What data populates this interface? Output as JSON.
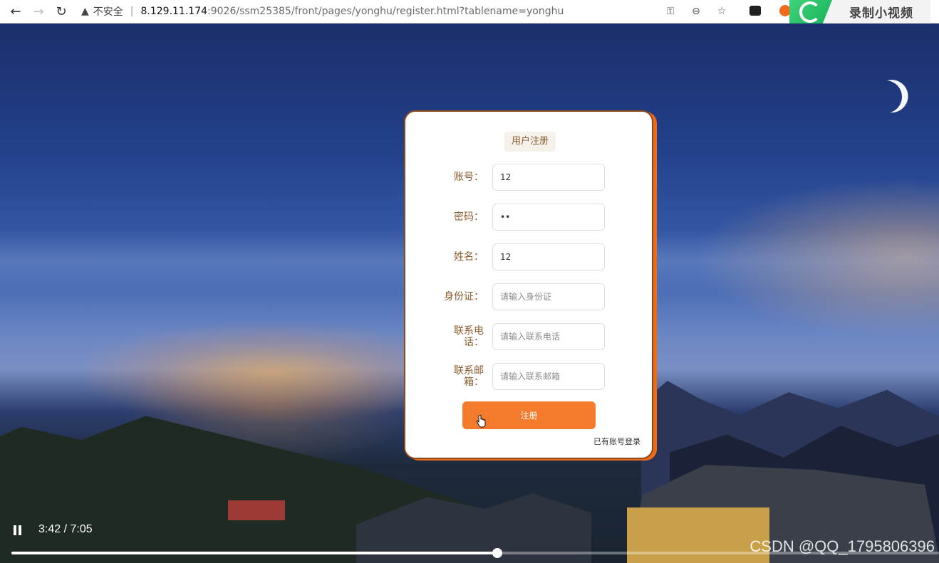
{
  "browser": {
    "security_label": "不安全",
    "url_host": "8.129.11.174",
    "url_rest": ":9026/ssm25385/front/pages/yonghu/register.html?tablename=yonghu",
    "icons": [
      "back-icon",
      "forward-icon",
      "refresh-icon",
      "warning-icon",
      "key-icon",
      "zoom-out-icon",
      "favorite-icon"
    ],
    "recorder_label": "录制小视频"
  },
  "form": {
    "title": "用户注册",
    "fields": [
      {
        "label": "账号：",
        "value": "12",
        "placeholder": "",
        "type": "text"
      },
      {
        "label": "密码：",
        "value": "12",
        "placeholder": "",
        "type": "password"
      },
      {
        "label": "姓名：",
        "value": "12",
        "placeholder": "",
        "type": "text"
      },
      {
        "label": "身份证：",
        "value": "",
        "placeholder": "请输入身份证",
        "type": "text"
      },
      {
        "label": "联系电话：",
        "value": "",
        "placeholder": "请输入联系电话",
        "type": "text"
      },
      {
        "label": "联系邮箱：",
        "value": "",
        "placeholder": "请输入联系邮箱",
        "type": "text"
      }
    ],
    "submit_label": "注册",
    "login_link": "已有账号登录",
    "colors": {
      "accent": "#f47a2c",
      "label": "#8b5a2b",
      "card_border": "#8a4a1d"
    }
  },
  "video": {
    "time": "3:42 / 7:05",
    "progress": 0.524,
    "watermark": "CSDN @QQ_1795806396"
  }
}
